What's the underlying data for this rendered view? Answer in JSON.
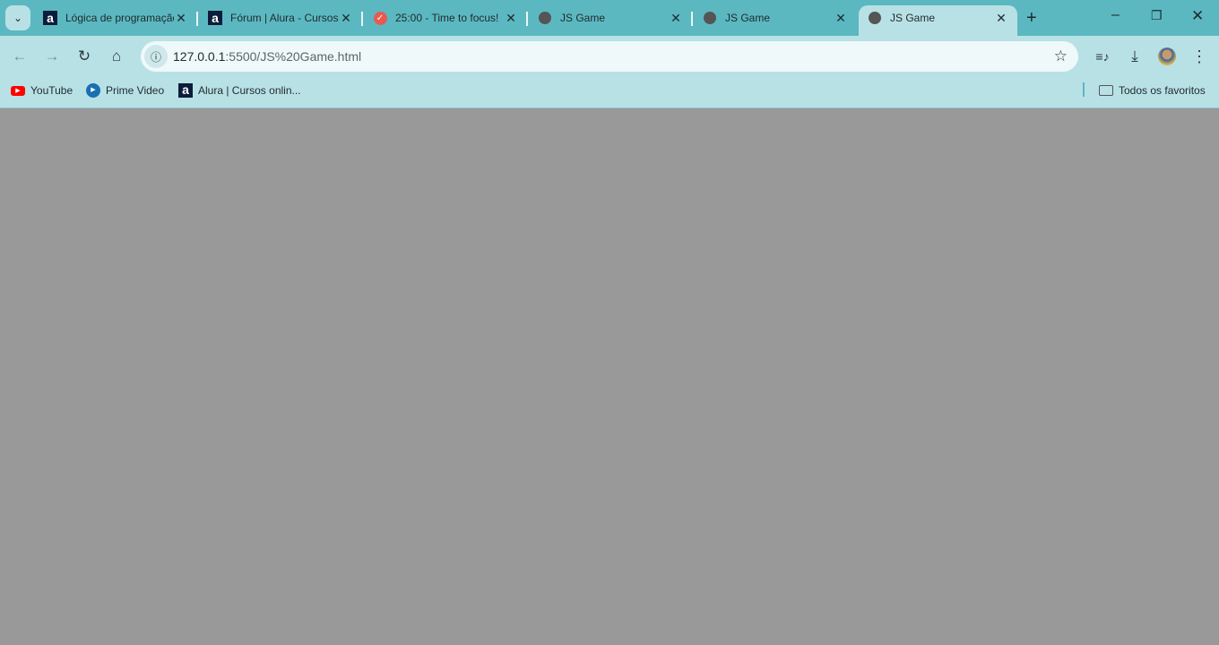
{
  "tabs": [
    {
      "title": "Lógica de programação",
      "icon": "alura-icon"
    },
    {
      "title": "Fórum | Alura - Cursos",
      "icon": "alura-icon"
    },
    {
      "title": "25:00 - Time to focus!",
      "icon": "pomodoro-check-icon"
    },
    {
      "title": "JS Game",
      "icon": "globe-icon"
    },
    {
      "title": "JS Game",
      "icon": "globe-icon"
    },
    {
      "title": "JS Game",
      "icon": "globe-icon",
      "active": true
    }
  ],
  "address": {
    "host": "127.0.0.1",
    "rest": ":5500/JS%20Game.html"
  },
  "bookmarks": [
    {
      "label": "YouTube"
    },
    {
      "label": "Prime Video"
    },
    {
      "label": "Alura | Cursos onlin..."
    }
  ],
  "all_bookmarks": "Todos os favoritos",
  "colors": {
    "tabbar": "#5bb8c1",
    "toolbar": "#b8e1e6",
    "page": "#999999"
  }
}
